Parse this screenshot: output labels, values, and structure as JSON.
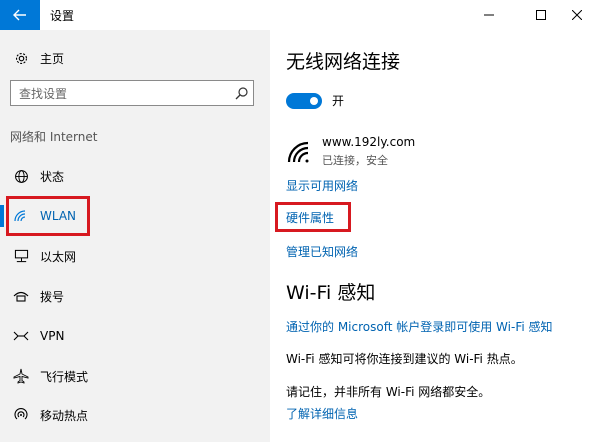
{
  "window": {
    "title": "设置",
    "controls": [
      "minimize",
      "maximize",
      "close"
    ]
  },
  "sidebar": {
    "home_label": "主页",
    "search_placeholder": "查找设置",
    "group_label": "网络和 Internet",
    "items": [
      {
        "label": "状态",
        "icon": "globe-icon"
      },
      {
        "label": "WLAN",
        "icon": "wifi-icon",
        "selected": true
      },
      {
        "label": "以太网",
        "icon": "ethernet-icon"
      },
      {
        "label": "拨号",
        "icon": "dialup-icon"
      },
      {
        "label": "VPN",
        "icon": "vpn-icon"
      },
      {
        "label": "飞行模式",
        "icon": "airplane-icon"
      },
      {
        "label": "移动热点",
        "icon": "hotspot-icon"
      }
    ]
  },
  "main": {
    "title": "无线网络连接",
    "toggle_state": "开",
    "network": {
      "name": "www.192ly.com",
      "status": "已连接，安全"
    },
    "links": {
      "show_available": "显示可用网络",
      "hardware_properties": "硬件属性",
      "manage_known": "管理已知网络"
    },
    "wifi_sense": {
      "title": "Wi-Fi 感知",
      "signin_link": "通过你的 Microsoft 帐户登录即可使用 Wi-Fi 感知",
      "description": "Wi-Fi 感知可将你连接到建议的 Wi-Fi 热点。",
      "note": "请记住，并非所有 Wi-Fi 网络都安全。",
      "learn_more": "了解详细信息"
    }
  },
  "colors": {
    "accent": "#0078d7",
    "link": "#0063b1",
    "highlight": "#d71920",
    "sidebar_bg": "#f2f2f2"
  }
}
